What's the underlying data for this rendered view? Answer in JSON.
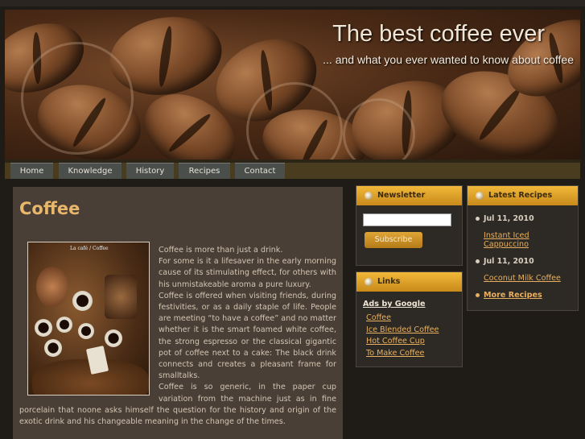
{
  "header": {
    "title": "The best coffee ever",
    "tagline": "... and what you ever wanted to know about coffee"
  },
  "nav": {
    "items": [
      {
        "label": "Home"
      },
      {
        "label": "Knowledge"
      },
      {
        "label": "History"
      },
      {
        "label": "Recipes"
      },
      {
        "label": "Contact"
      }
    ]
  },
  "main": {
    "title": "Coffee",
    "image_label": "La café / Coffee",
    "paragraphs": [
      "Coffee is more than just a drink.",
      "For some is it a lifesaver in the early morning cause of its stimulating effect, for others with his unmistakeable aroma a pure luxury.",
      "Coffee is offered when visiting friends, during festivities, or as a daily staple of life. People are meeting “to have a coffee” and no matter whether it is the smart foamed white coffee, the strong espresso or the classical gigantic pot of coffee next to a cake: The black drink connects and creates a pleasant frame for smalltalks.",
      "Coffee is so generic, in the paper cup variation from the machine just as in fine porcelain that noone asks himself the question for the history and origin of the exotic drink and his changeable meaning in the change of the times."
    ]
  },
  "newsletter": {
    "title": "Newsletter",
    "email_value": "",
    "subscribe_label": "Subscribe"
  },
  "links": {
    "title": "Links",
    "ads_label": "Ads by Google",
    "items": [
      {
        "label": "Coffee"
      },
      {
        "label": "Ice Blended Coffee"
      },
      {
        "label": "Hot Coffee Cup"
      },
      {
        "label": "To Make Coffee"
      }
    ]
  },
  "recipes": {
    "title": "Latest Recipes",
    "entries": [
      {
        "date": "Jul 11, 2010",
        "link": "Instant Iced Cappuccino"
      },
      {
        "date": "Jul 11, 2010",
        "link": "Coconut Milk Coffee"
      }
    ],
    "more_label": "More Recipes"
  },
  "colors": {
    "accent": "#e8b76a",
    "box_header": "#e0a636",
    "link": "#e8b060",
    "background": "#1f1b17",
    "content_bg": "#4a3f37",
    "nav_bar": "#4a3c1e"
  }
}
